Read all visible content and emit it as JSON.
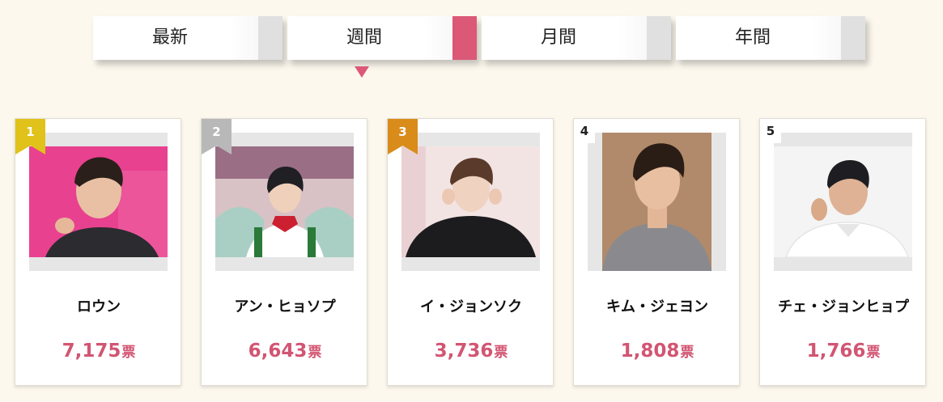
{
  "tabs": [
    {
      "label": "最新",
      "active": false
    },
    {
      "label": "週間",
      "active": true
    },
    {
      "label": "月間",
      "active": false
    },
    {
      "label": "年間",
      "active": false
    }
  ],
  "colors": {
    "accent": "#dc5877",
    "vote_text": "#d25572",
    "rank_gold": "#e0c21a",
    "rank_silver": "#b8b8b8",
    "rank_bronze": "#d98c1a",
    "background": "#fcf8ee"
  },
  "ranking": [
    {
      "rank": "1",
      "name": "ロウン",
      "votes": "7,175",
      "unit": "票",
      "badge": "gold"
    },
    {
      "rank": "2",
      "name": "アン・ヒョソプ",
      "votes": "6,643",
      "unit": "票",
      "badge": "silver"
    },
    {
      "rank": "3",
      "name": "イ・ジョンソク",
      "votes": "3,736",
      "unit": "票",
      "badge": "bronze"
    },
    {
      "rank": "4",
      "name": "キム・ジェヨン",
      "votes": "1,808",
      "unit": "票",
      "badge": "plain"
    },
    {
      "rank": "5",
      "name": "チェ・ジョンヒョプ",
      "votes": "1,766",
      "unit": "票",
      "badge": "plain"
    }
  ]
}
